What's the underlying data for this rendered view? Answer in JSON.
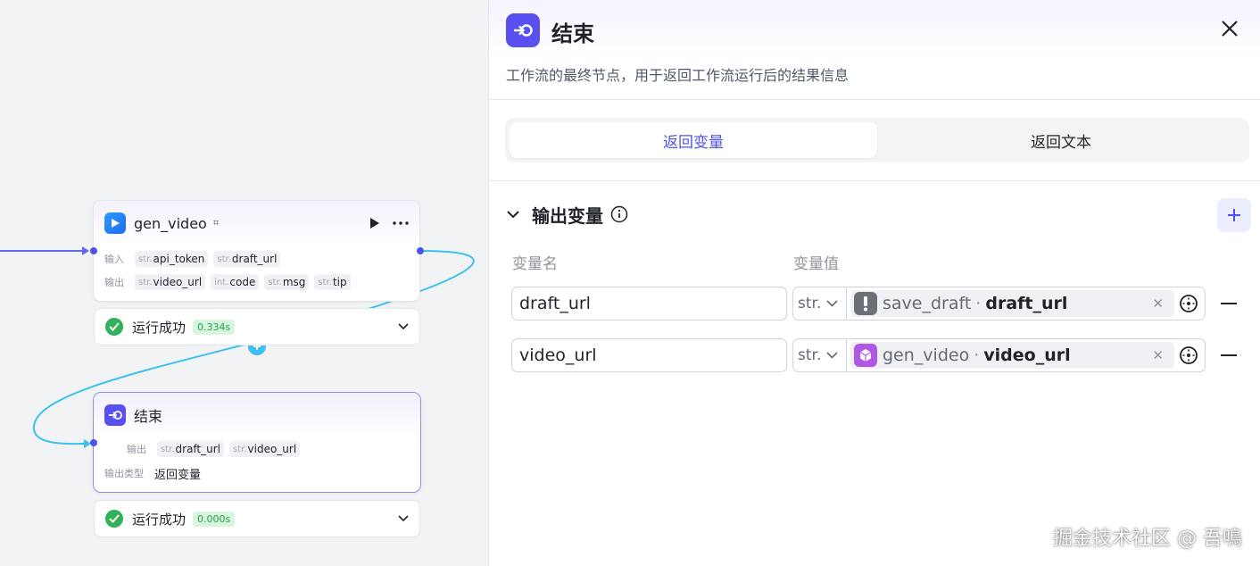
{
  "canvas": {
    "gen_video_node": {
      "title": "gen_video",
      "badge": "⌗",
      "input_label": "输入",
      "output_label": "输出",
      "inputs": [
        {
          "type": "str.",
          "name": "api_token"
        },
        {
          "type": "str.",
          "name": "draft_url"
        }
      ],
      "outputs": [
        {
          "type": "str.",
          "name": "video_url"
        },
        {
          "type": "int.",
          "name": "code"
        },
        {
          "type": "str.",
          "name": "msg"
        },
        {
          "type": "str.",
          "name": "tip"
        }
      ],
      "status": "运行成功",
      "time": "0.334s"
    },
    "end_node": {
      "title": "结束",
      "output_label": "输出",
      "outputs": [
        {
          "type": "str.",
          "name": "draft_url"
        },
        {
          "type": "str.",
          "name": "video_url"
        }
      ],
      "output_type_label": "输出类型",
      "output_type_value": "返回变量",
      "status": "运行成功",
      "time": "0.000s"
    }
  },
  "panel": {
    "title": "结束",
    "description": "工作流的最终节点，用于返回工作流运行后的结果信息",
    "tabs": [
      {
        "label": "返回变量",
        "active": true
      },
      {
        "label": "返回文本",
        "active": false
      }
    ],
    "section_title": "输出变量",
    "col_name": "变量名",
    "col_value": "变量值",
    "rows": [
      {
        "name": "draft_url",
        "type": "str.",
        "ref_node": "save_draft",
        "ref_field": "draft_url",
        "ref_icon": "exclamation-icon",
        "ref_color": "#6b6f76"
      },
      {
        "name": "video_url",
        "type": "str.",
        "ref_node": "gen_video",
        "ref_field": "video_url",
        "ref_icon": "cube-icon",
        "ref_color": "#b157e8"
      }
    ]
  },
  "watermark": "掘金技术社区 @ 吾鳴",
  "colors": {
    "accent": "#4d53e8",
    "success": "#32b05a",
    "edge": "#3ec0ef"
  }
}
